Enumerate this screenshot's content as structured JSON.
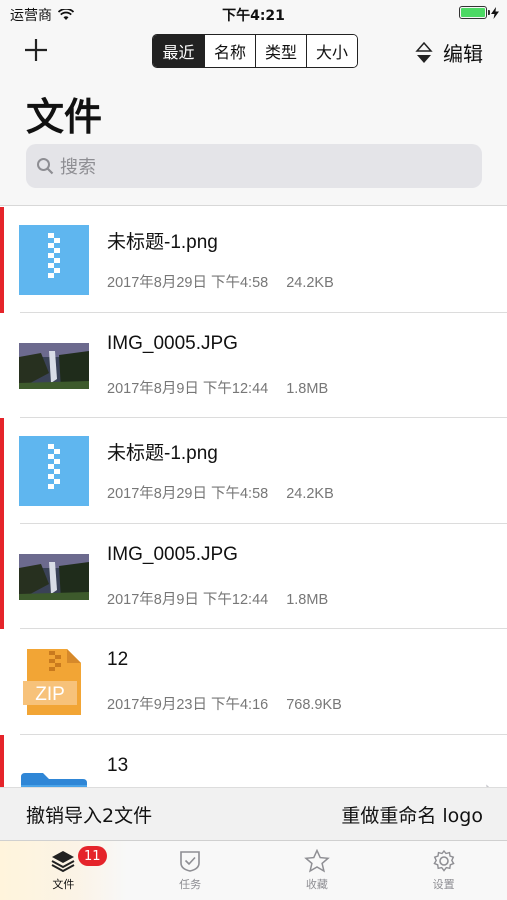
{
  "status_bar": {
    "carrier": "运营商",
    "time": "下午4:21"
  },
  "header": {
    "sort_tabs": [
      "最近",
      "名称",
      "类型",
      "大小"
    ],
    "edit_label": "编辑",
    "title": "文件",
    "search_placeholder": "搜索"
  },
  "files": [
    {
      "name": "未标题-1.png",
      "date": "2017年8月29日 下午4:58",
      "size": "24.2KB",
      "icon": "png-file-icon",
      "marked": true
    },
    {
      "name": "IMG_0005.JPG",
      "date": "2017年8月9日 下午12:44",
      "size": "1.8MB",
      "icon": "photo-thumbnail",
      "marked": false
    },
    {
      "name": "未标题-1.png",
      "date": "2017年8月29日 下午4:58",
      "size": "24.2KB",
      "icon": "png-file-icon",
      "marked": true
    },
    {
      "name": "IMG_0005.JPG",
      "date": "2017年8月9日 下午12:44",
      "size": "1.8MB",
      "icon": "photo-thumbnail",
      "marked": true
    },
    {
      "name": "12",
      "date": "2017年9月23日 下午4:16",
      "size": "768.9KB",
      "icon": "zip-file-icon",
      "marked": false
    },
    {
      "name": "13",
      "date": "",
      "size": "",
      "icon": "folder-icon",
      "marked": true
    }
  ],
  "toast": {
    "undo_text": "撤销导入2文件",
    "redo_text": "重做重命名 logo"
  },
  "tabbar": {
    "tabs": [
      {
        "label": "文件",
        "icon": "stack-icon",
        "badge": "11"
      },
      {
        "label": "任务",
        "icon": "shield-check-icon"
      },
      {
        "label": "收藏",
        "icon": "star-icon"
      },
      {
        "label": "设置",
        "icon": "gear-icon"
      }
    ]
  },
  "colors": {
    "accent_red": "#e5242a",
    "file_blue": "#5fb6ef",
    "zip_orange": "#f2a535"
  }
}
